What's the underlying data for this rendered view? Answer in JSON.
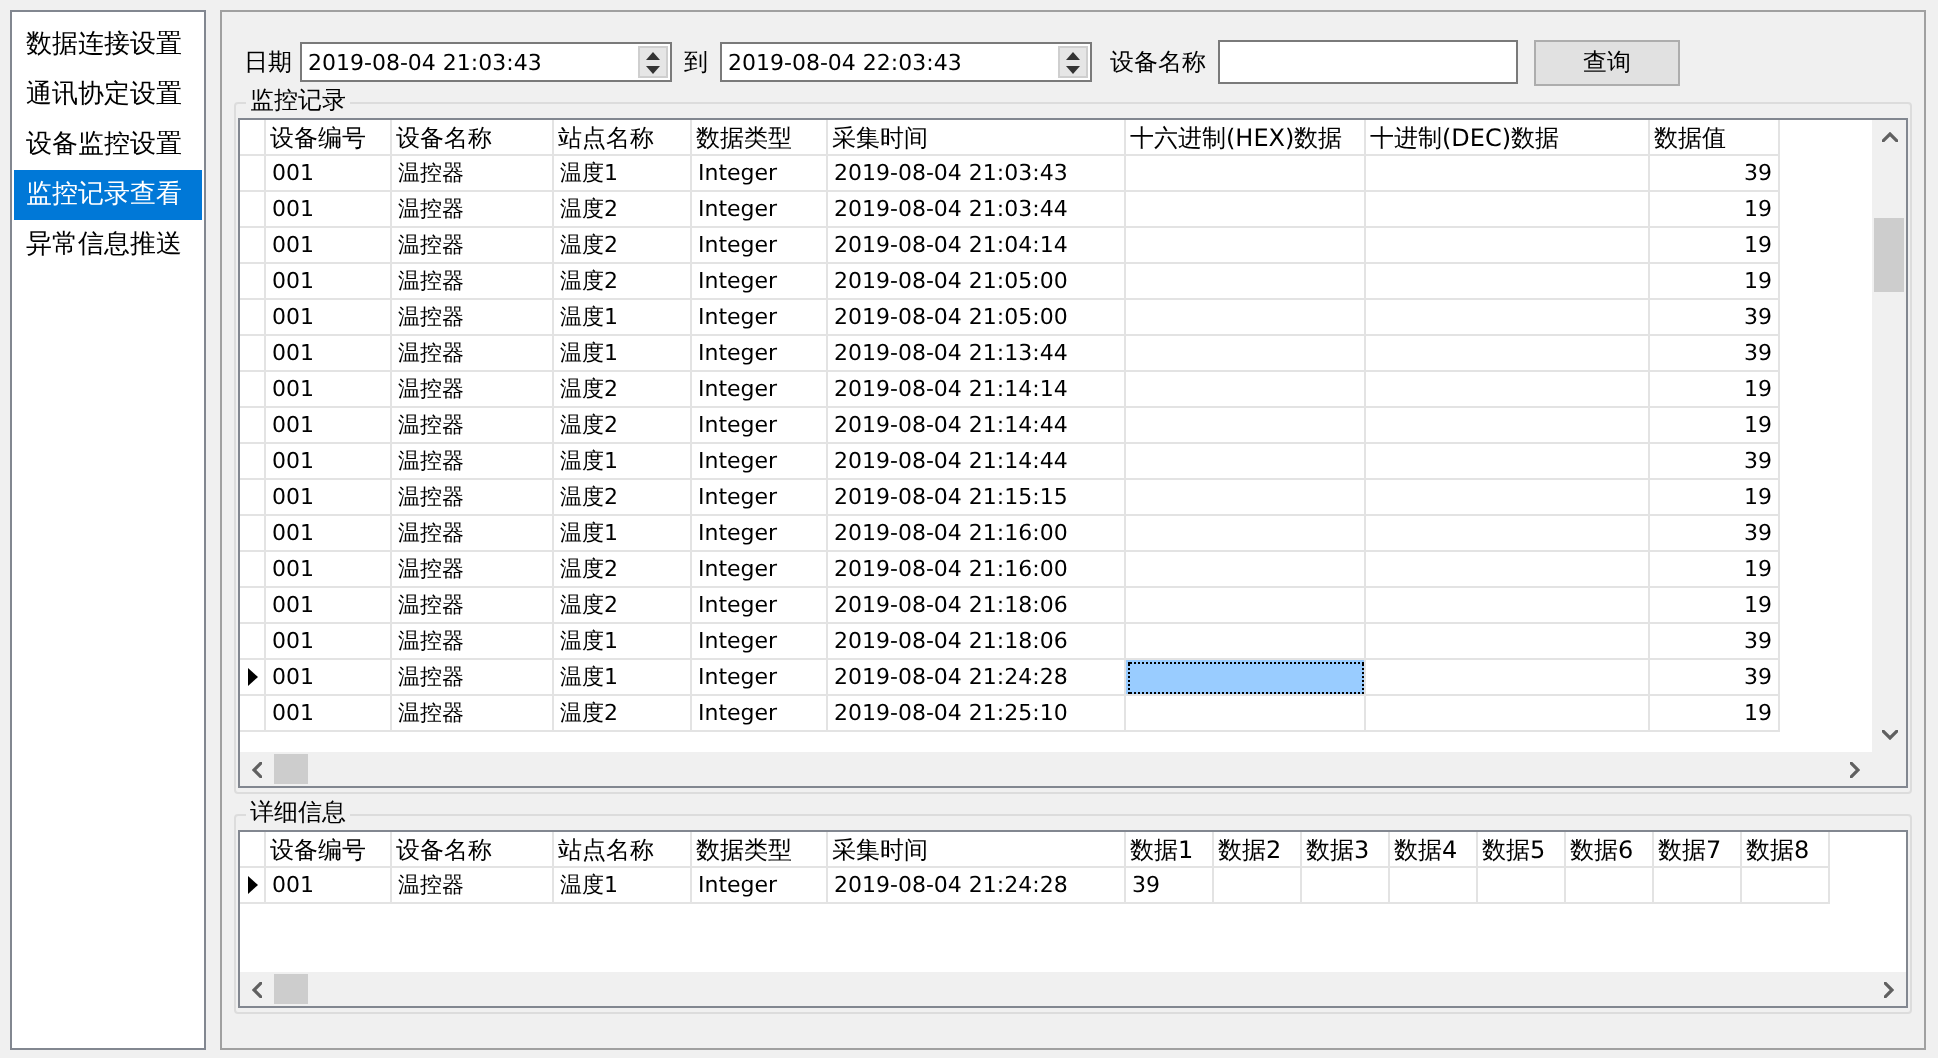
{
  "sidebar": {
    "items": [
      {
        "label": "数据连接设置",
        "selected": false
      },
      {
        "label": "通讯协定设置",
        "selected": false
      },
      {
        "label": "设备监控设置",
        "selected": false
      },
      {
        "label": "监控记录查看",
        "selected": true
      },
      {
        "label": "异常信息推送",
        "selected": false
      }
    ]
  },
  "query": {
    "date_label": "日期",
    "from": "2019-08-04 21:03:43",
    "to_label": "到",
    "to": "2019-08-04 22:03:43",
    "device_label": "设备名称",
    "search_button": "查询"
  },
  "records": {
    "title": "监控记录",
    "columns": [
      "设备编号",
      "设备名称",
      "站点名称",
      "数据类型",
      "采集时间",
      "十六进制(HEX)数据",
      "十进制(DEC)数据",
      "数据值"
    ],
    "rows": [
      {
        "device_no": "001",
        "device_name": "温控器",
        "station": "温度1",
        "data_type": "Integer",
        "time": "2019-08-04 21:03:43",
        "value": "39",
        "current": false,
        "hex_selected": false
      },
      {
        "device_no": "001",
        "device_name": "温控器",
        "station": "温度2",
        "data_type": "Integer",
        "time": "2019-08-04 21:03:44",
        "value": "19",
        "current": false,
        "hex_selected": false
      },
      {
        "device_no": "001",
        "device_name": "温控器",
        "station": "温度2",
        "data_type": "Integer",
        "time": "2019-08-04 21:04:14",
        "value": "19",
        "current": false,
        "hex_selected": false
      },
      {
        "device_no": "001",
        "device_name": "温控器",
        "station": "温度2",
        "data_type": "Integer",
        "time": "2019-08-04 21:05:00",
        "value": "19",
        "current": false,
        "hex_selected": false
      },
      {
        "device_no": "001",
        "device_name": "温控器",
        "station": "温度1",
        "data_type": "Integer",
        "time": "2019-08-04 21:05:00",
        "value": "39",
        "current": false,
        "hex_selected": false
      },
      {
        "device_no": "001",
        "device_name": "温控器",
        "station": "温度1",
        "data_type": "Integer",
        "time": "2019-08-04 21:13:44",
        "value": "39",
        "current": false,
        "hex_selected": false
      },
      {
        "device_no": "001",
        "device_name": "温控器",
        "station": "温度2",
        "data_type": "Integer",
        "time": "2019-08-04 21:14:14",
        "value": "19",
        "current": false,
        "hex_selected": false
      },
      {
        "device_no": "001",
        "device_name": "温控器",
        "station": "温度2",
        "data_type": "Integer",
        "time": "2019-08-04 21:14:44",
        "value": "19",
        "current": false,
        "hex_selected": false
      },
      {
        "device_no": "001",
        "device_name": "温控器",
        "station": "温度1",
        "data_type": "Integer",
        "time": "2019-08-04 21:14:44",
        "value": "39",
        "current": false,
        "hex_selected": false
      },
      {
        "device_no": "001",
        "device_name": "温控器",
        "station": "温度2",
        "data_type": "Integer",
        "time": "2019-08-04 21:15:15",
        "value": "19",
        "current": false,
        "hex_selected": false
      },
      {
        "device_no": "001",
        "device_name": "温控器",
        "station": "温度1",
        "data_type": "Integer",
        "time": "2019-08-04 21:16:00",
        "value": "39",
        "current": false,
        "hex_selected": false
      },
      {
        "device_no": "001",
        "device_name": "温控器",
        "station": "温度2",
        "data_type": "Integer",
        "time": "2019-08-04 21:16:00",
        "value": "19",
        "current": false,
        "hex_selected": false
      },
      {
        "device_no": "001",
        "device_name": "温控器",
        "station": "温度2",
        "data_type": "Integer",
        "time": "2019-08-04 21:18:06",
        "value": "19",
        "current": false,
        "hex_selected": false
      },
      {
        "device_no": "001",
        "device_name": "温控器",
        "station": "温度1",
        "data_type": "Integer",
        "time": "2019-08-04 21:18:06",
        "value": "39",
        "current": false,
        "hex_selected": false
      },
      {
        "device_no": "001",
        "device_name": "温控器",
        "station": "温度1",
        "data_type": "Integer",
        "time": "2019-08-04 21:24:28",
        "value": "39",
        "current": true,
        "hex_selected": true
      },
      {
        "device_no": "001",
        "device_name": "温控器",
        "station": "温度2",
        "data_type": "Integer",
        "time": "2019-08-04 21:25:10",
        "value": "19",
        "current": false,
        "hex_selected": false
      }
    ]
  },
  "details": {
    "title": "详细信息",
    "columns": [
      "设备编号",
      "设备名称",
      "站点名称",
      "数据类型",
      "采集时间",
      "数据1",
      "数据2",
      "数据3",
      "数据4",
      "数据5",
      "数据6",
      "数据7",
      "数据8"
    ],
    "rows": [
      {
        "device_no": "001",
        "device_name": "温控器",
        "station": "温度1",
        "data_type": "Integer",
        "time": "2019-08-04 21:24:28",
        "data": [
          "39"
        ],
        "current": true
      }
    ]
  }
}
